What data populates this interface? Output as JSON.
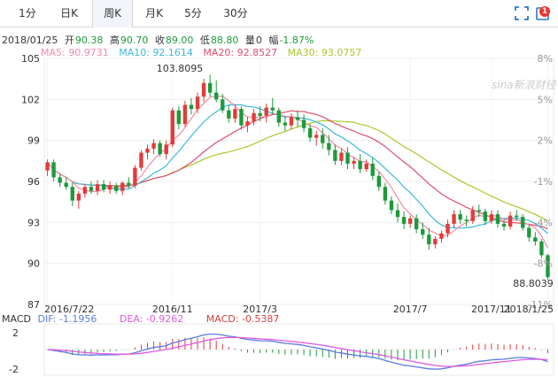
{
  "tabs": [
    {
      "label": "1分",
      "active": false
    },
    {
      "label": "日K",
      "active": false
    },
    {
      "label": "周K",
      "active": true
    },
    {
      "label": "月K",
      "active": false
    },
    {
      "label": "5分",
      "active": false
    },
    {
      "label": "30分",
      "active": false
    }
  ],
  "toolbar": {
    "badge": "1"
  },
  "quote": {
    "date": "2018/01/25",
    "open_label": "开",
    "open": "90.38",
    "high_label": "高",
    "high": "90.70",
    "close_label": "收",
    "close": "89.00",
    "low_label": "低",
    "low": "88.80",
    "vol_label": "量",
    "vol": "0",
    "chg_label": "幅",
    "chg": "-1.87%"
  },
  "ma": {
    "ma5": "MA5: 90.9731",
    "ma10": "MA10: 92.1614",
    "ma20": "MA20: 92.8527",
    "ma30": "MA30: 93.0757"
  },
  "colors": {
    "up": "#e23b3b",
    "down": "#1c9a3a",
    "ma5": "#f08ca6",
    "ma10": "#3cb8dc",
    "ma20": "#dd4f6e",
    "ma30": "#a9c82c",
    "dif": "#5a7be0",
    "dea": "#e05ae0",
    "macd_label": "#d04040",
    "quote_value": "#1c9a3a"
  },
  "watermark": "sina新浪财经",
  "chart_data": {
    "type": "candlestick",
    "y_left_ticks": [
      "105",
      "102",
      "99",
      "96",
      "93",
      "90",
      "87"
    ],
    "y_right_ticks": [
      "8%",
      "5%",
      "2%",
      "-1%",
      "-4%",
      "-8%",
      "-11%"
    ],
    "x_ticks": [
      "2016/7/22",
      "2016/11",
      "2017/3",
      "2017/7",
      "2017/11",
      "2018/1/25"
    ],
    "ylim": [
      87,
      105
    ],
    "max_label": "103.8095",
    "min_label": "88.8039",
    "candles": [
      [
        96.8,
        97.6,
        96.4,
        97.4
      ],
      [
        97.4,
        97.6,
        96.0,
        96.3
      ],
      [
        96.3,
        96.6,
        95.6,
        95.9
      ],
      [
        95.9,
        96.3,
        95.4,
        95.6
      ],
      [
        95.6,
        95.9,
        94.2,
        94.6
      ],
      [
        94.6,
        95.3,
        94.0,
        95.1
      ],
      [
        95.1,
        95.8,
        94.8,
        95.6
      ],
      [
        95.6,
        96.0,
        95.1,
        95.3
      ],
      [
        95.3,
        96.1,
        95.0,
        95.8
      ],
      [
        95.8,
        96.1,
        95.2,
        95.4
      ],
      [
        95.4,
        96.0,
        95.1,
        95.7
      ],
      [
        95.7,
        95.9,
        95.1,
        95.3
      ],
      [
        95.3,
        96.0,
        95.0,
        95.9
      ],
      [
        95.9,
        96.3,
        95.5,
        95.7
      ],
      [
        95.7,
        97.2,
        95.5,
        97.0
      ],
      [
        97.0,
        98.3,
        96.8,
        98.1
      ],
      [
        98.1,
        98.7,
        97.6,
        98.4
      ],
      [
        98.4,
        99.1,
        98.0,
        98.8
      ],
      [
        98.8,
        99.0,
        97.8,
        98.0
      ],
      [
        98.0,
        99.0,
        97.6,
        98.7
      ],
      [
        98.7,
        101.4,
        98.5,
        101.2
      ],
      [
        101.2,
        101.5,
        99.8,
        100.2
      ],
      [
        100.2,
        101.9,
        100.0,
        101.6
      ],
      [
        101.6,
        102.1,
        100.9,
        101.3
      ],
      [
        101.3,
        102.5,
        101.0,
        102.2
      ],
      [
        102.2,
        103.5,
        101.8,
        103.2
      ],
      [
        103.2,
        103.8,
        102.2,
        102.5
      ],
      [
        102.5,
        103.4,
        101.8,
        102.0
      ],
      [
        102.0,
        102.4,
        101.0,
        101.2
      ],
      [
        101.2,
        101.6,
        100.3,
        100.6
      ],
      [
        100.6,
        101.6,
        100.3,
        101.3
      ],
      [
        101.3,
        101.5,
        99.8,
        100.1
      ],
      [
        100.1,
        100.7,
        99.6,
        100.4
      ],
      [
        100.4,
        101.3,
        100.1,
        101.0
      ],
      [
        101.0,
        101.5,
        100.4,
        100.8
      ],
      [
        100.8,
        101.7,
        100.3,
        101.4
      ],
      [
        101.4,
        102.1,
        100.9,
        101.2
      ],
      [
        101.2,
        101.4,
        100.0,
        100.3
      ],
      [
        100.3,
        100.8,
        99.7,
        100.1
      ],
      [
        100.1,
        101.0,
        99.8,
        100.7
      ],
      [
        100.7,
        101.2,
        100.0,
        100.5
      ],
      [
        100.5,
        100.9,
        99.6,
        99.9
      ],
      [
        99.9,
        100.2,
        98.9,
        99.2
      ],
      [
        99.2,
        99.7,
        98.6,
        99.4
      ],
      [
        99.4,
        99.9,
        98.4,
        98.8
      ],
      [
        98.8,
        99.4,
        97.9,
        98.3
      ],
      [
        98.3,
        98.7,
        97.2,
        97.5
      ],
      [
        97.5,
        98.4,
        97.2,
        98.1
      ],
      [
        98.1,
        98.5,
        96.9,
        97.3
      ],
      [
        97.3,
        97.8,
        96.9,
        97.5
      ],
      [
        97.5,
        98.0,
        96.6,
        96.9
      ],
      [
        96.9,
        97.6,
        96.7,
        97.3
      ],
      [
        97.3,
        97.7,
        96.1,
        96.4
      ],
      [
        96.4,
        96.7,
        95.3,
        95.6
      ],
      [
        95.6,
        95.9,
        94.3,
        94.6
      ],
      [
        94.6,
        94.9,
        93.6,
        93.9
      ],
      [
        93.9,
        94.4,
        93.0,
        93.4
      ],
      [
        93.4,
        93.8,
        92.5,
        92.9
      ],
      [
        92.9,
        93.5,
        92.6,
        93.3
      ],
      [
        93.3,
        93.6,
        92.2,
        92.5
      ],
      [
        92.5,
        93.0,
        91.8,
        92.1
      ],
      [
        92.1,
        92.6,
        91.0,
        91.4
      ],
      [
        91.4,
        92.0,
        91.1,
        91.8
      ],
      [
        91.8,
        92.4,
        91.5,
        92.2
      ],
      [
        92.2,
        93.2,
        91.9,
        92.9
      ],
      [
        92.9,
        93.9,
        92.6,
        93.6
      ],
      [
        93.6,
        93.9,
        92.9,
        93.2
      ],
      [
        93.2,
        93.5,
        92.7,
        93.1
      ],
      [
        93.1,
        94.2,
        92.9,
        93.9
      ],
      [
        93.9,
        94.3,
        93.4,
        93.8
      ],
      [
        93.8,
        94.0,
        92.8,
        93.1
      ],
      [
        93.1,
        93.9,
        92.9,
        93.6
      ],
      [
        93.6,
        93.9,
        92.6,
        92.9
      ],
      [
        92.9,
        93.2,
        92.4,
        92.7
      ],
      [
        92.7,
        93.8,
        92.5,
        93.5
      ],
      [
        93.5,
        93.9,
        93.1,
        93.4
      ],
      [
        93.4,
        93.6,
        92.4,
        92.6
      ],
      [
        92.6,
        92.8,
        91.6,
        91.9
      ],
      [
        91.9,
        92.3,
        91.3,
        91.6
      ],
      [
        91.6,
        91.8,
        90.4,
        90.6
      ],
      [
        90.6,
        90.7,
        88.8,
        89.0
      ]
    ],
    "macd_ticks": [
      "2",
      "-2"
    ],
    "macd_legend": {
      "title": "MACD",
      "dif": "DIF: -1.1956",
      "dea": "DEA: -0.9262",
      "macd": "MACD: -0.5387"
    }
  }
}
